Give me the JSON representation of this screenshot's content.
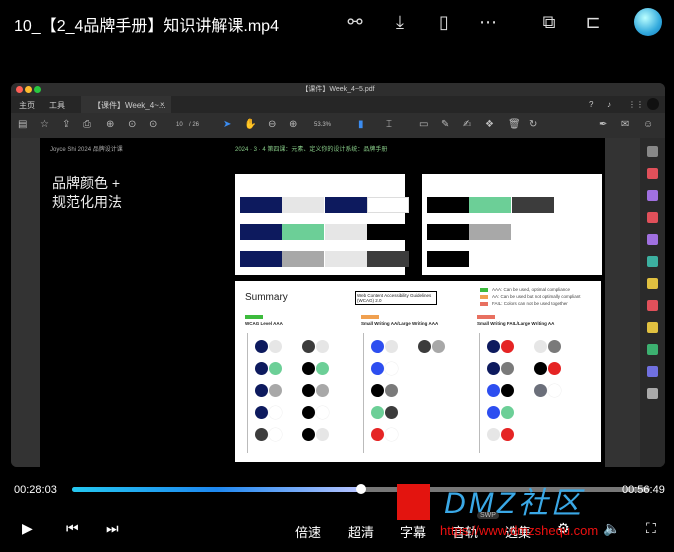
{
  "header": {
    "title": "10_【2_4品牌手册】知识讲解课.mp4",
    "icons": [
      "share-icon",
      "download-icon",
      "phone-icon",
      "more-icon",
      "pip-icon",
      "pin-icon",
      "avatar"
    ]
  },
  "pdf": {
    "window_title": "【课件】Week_4~5.pdf",
    "tabs": {
      "home": "主页",
      "tools": "工具",
      "doc": "【课件】Week_4~...",
      "close": "×"
    },
    "page": "10",
    "pages": "/ 26",
    "zoom": "53.3%",
    "slide": {
      "author": "Joyce Shi 2024 品牌设计课",
      "subtitle": "2024 · 3 · 4 第四课：元素、定义你的设计系统：品牌手册",
      "heading1": "品牌颜色 +",
      "heading2": "规范化用法",
      "summary": {
        "title": "Summary",
        "link": "Web Content Accessibility Guidelines (WCAG) 2.0",
        "legend": [
          {
            "label": "AAA: Can be used, optimal compliance",
            "color": "#3dbb3d"
          },
          {
            "label": "AA: Can be used but not optimally compliant",
            "color": "#f0a050"
          },
          {
            "label": "FAIL: Colors can not be used together",
            "color": "#e87060"
          }
        ],
        "columns": [
          {
            "tag_color": "#3dbb3d",
            "title": "WCAG Level AAA",
            "pairs": [
              [
                "#0d1a5e",
                "#e6e6e6"
              ],
              [
                "#3c3c3c",
                "#e6e6e6"
              ],
              [
                "#0d1a5e",
                "#6ccf97"
              ],
              [
                "#000000",
                "#6ccf97"
              ],
              [
                "#0d1a5e",
                "#a8a8a8"
              ],
              [
                "#000000",
                "#a8a8a8"
              ],
              [
                "#0d1a5e",
                "#ffffff"
              ],
              [
                "#000000",
                "#ffffff"
              ],
              [
                "#3c3c3c",
                "#ffffff"
              ],
              [
                "#000000",
                "#e6e6e6"
              ]
            ]
          },
          {
            "tag_color": "#f0a050",
            "title": "Small Writing AA/Large Writing AAA",
            "pairs": [
              [
                "#2d4ef0",
                "#e6e6e6"
              ],
              [
                "#3c3c3c",
                "#a8a8a8"
              ],
              [
                "#2d4ef0",
                "#ffffff"
              ],
              null,
              [
                "#000000",
                "#7a7a7a"
              ],
              null,
              [
                "#6ccf97",
                "#3c3c3c"
              ],
              null,
              [
                "#e52424",
                "#ffffff"
              ],
              null
            ]
          },
          {
            "tag_color": "#e87060",
            "title": "Small Writing FAIL/Large Writing AA",
            "pairs": [
              [
                "#0d1a5e",
                "#e52424"
              ],
              [
                "#e6e6e6",
                "#7a7a7a"
              ],
              [
                "#0d1a5e",
                "#7a7a7a"
              ],
              [
                "#000000",
                "#e52424"
              ],
              [
                "#2d4ef0",
                "#000000"
              ],
              [
                "#6b6f7a",
                "#ffffff"
              ],
              [
                "#2d4ef0",
                "#6ccf97"
              ],
              null,
              [
                "#e6e6e6",
                "#e52424"
              ],
              null
            ]
          }
        ]
      }
    }
  },
  "player": {
    "current": "00:28:03",
    "duration": "00:56:49",
    "progress": 0.5,
    "buttons": {
      "speed": "倍速",
      "quality": "超清",
      "subtitle": "字幕",
      "audio": "音轨",
      "episodes": "选集"
    }
  },
  "watermark": {
    "text": "DMZ社区",
    "url": "https://www.dmzshequ.com",
    "badge": "SWP"
  }
}
